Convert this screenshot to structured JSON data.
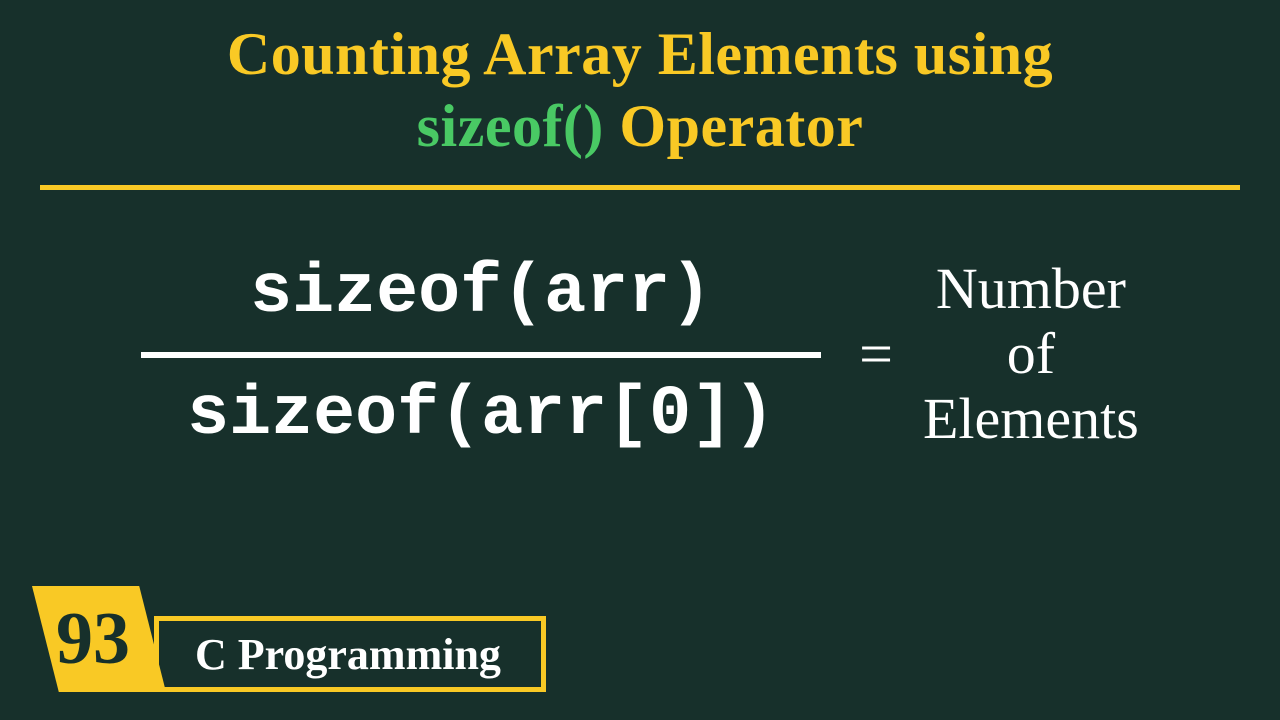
{
  "title": {
    "line1": "Counting Array Elements using",
    "highlight": "sizeof()",
    "line2_suffix": " Operator"
  },
  "formula": {
    "numerator": "sizeof(arr)",
    "denominator": "sizeof(arr[0])",
    "equals": "=",
    "result_line1": "Number",
    "result_line2": "of",
    "result_line3": "Elements"
  },
  "lesson": {
    "number": "93",
    "course": "C Programming"
  }
}
